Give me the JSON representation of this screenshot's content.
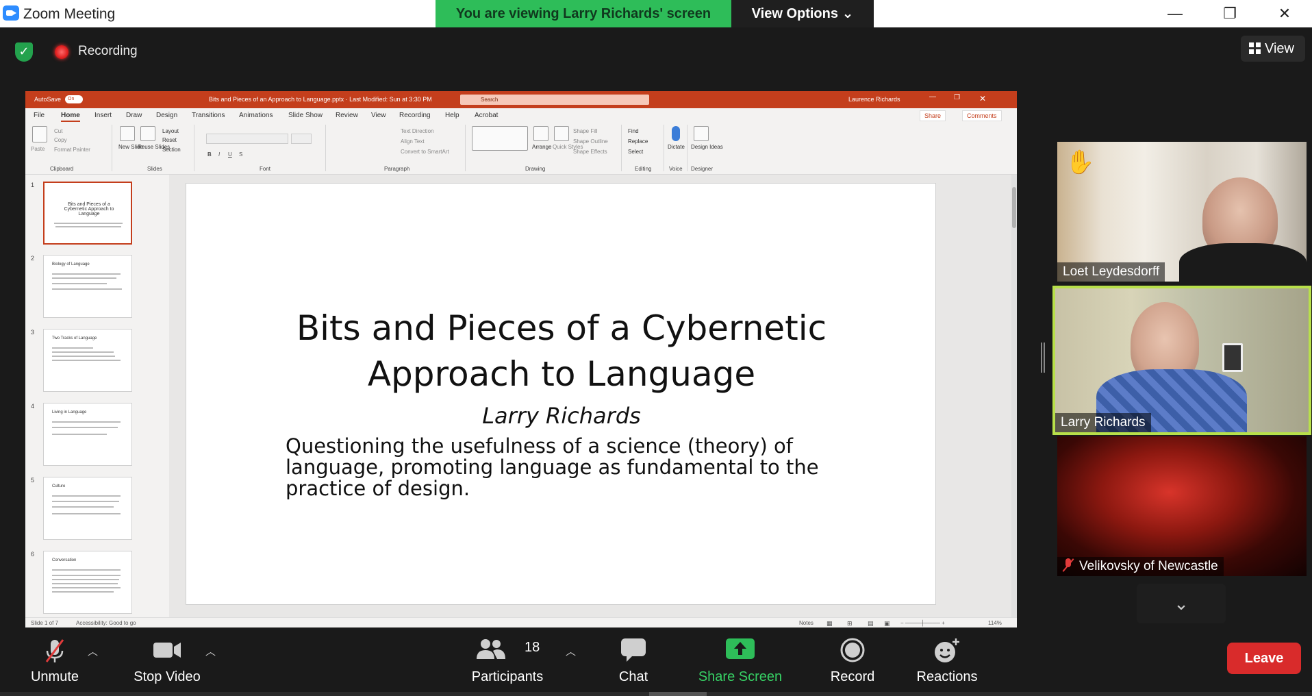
{
  "window": {
    "title": "Zoom Meeting",
    "banner": "You are viewing Larry Richards' screen",
    "view_options": "View Options"
  },
  "top": {
    "recording_label": "Recording",
    "view_label": "View"
  },
  "ppt": {
    "autosave": "AutoSave",
    "autosave_state": "On",
    "file_title": "Bits and Pieces of an Approach to Language.pptx  ·  Last Modified: Sun at 3:30 PM",
    "search_placeholder": "Search",
    "user": "Laurence Richards",
    "menu": [
      "File",
      "Home",
      "Insert",
      "Draw",
      "Design",
      "Transitions",
      "Animations",
      "Slide Show",
      "Review",
      "View",
      "Recording",
      "Help",
      "Acrobat"
    ],
    "share": "Share",
    "comments": "Comments",
    "ribbon": {
      "paste": "Paste",
      "cut": "Cut",
      "copy": "Copy",
      "format_painter": "Format Painter",
      "new_slide": "New Slide",
      "reuse_slides": "Reuse Slides",
      "layout": "Layout",
      "reset": "Reset",
      "section": "Section",
      "text_direction": "Text Direction",
      "align_text": "Align Text",
      "convert_smartart": "Convert to SmartArt",
      "arrange": "Arrange",
      "quick_styles": "Quick Styles",
      "shape_fill": "Shape Fill",
      "shape_outline": "Shape Outline",
      "shape_effects": "Shape Effects",
      "find": "Find",
      "replace": "Replace",
      "select": "Select",
      "dictate": "Dictate",
      "design_ideas": "Design Ideas",
      "groups": [
        "Clipboard",
        "Slides",
        "Font",
        "Paragraph",
        "Drawing",
        "Editing",
        "Voice",
        "Designer"
      ]
    },
    "thumbnails": [
      {
        "num": "1",
        "title": "Bits and Pieces of a Cybernetic Approach to Language"
      },
      {
        "num": "2",
        "title": "Biology of Language"
      },
      {
        "num": "3",
        "title": "Two Tracks of Language"
      },
      {
        "num": "4",
        "title": "Living in Language"
      },
      {
        "num": "5",
        "title": "Culture"
      },
      {
        "num": "6",
        "title": "Conversation"
      }
    ],
    "slide": {
      "title_line1": "Bits and Pieces of a Cybernetic",
      "title_line2": "Approach to Language",
      "author": "Larry Richards",
      "subtitle": "Questioning the usefulness of a science (theory) of language, promoting language as fundamental to the practice of design."
    },
    "status": {
      "slide_count": "Slide 1 of 7",
      "accessibility": "Accessibility: Good to go",
      "notes": "Notes",
      "zoom": "114%"
    }
  },
  "participants": [
    {
      "name": "Loet Leydesdorff",
      "raised_hand": true,
      "muted": false
    },
    {
      "name": "Larry Richards",
      "raised_hand": false,
      "muted": false,
      "active_speaker": true
    },
    {
      "name": "Velikovsky of Newcastle",
      "raised_hand": false,
      "muted": true
    }
  ],
  "toolbar": {
    "unmute": "Unmute",
    "stop_video": "Stop Video",
    "participants": "Participants",
    "participants_count": "18",
    "chat": "Chat",
    "share_screen": "Share Screen",
    "record": "Record",
    "reactions": "Reactions",
    "leave": "Leave"
  },
  "colors": {
    "share_green": "#2ebd59",
    "ppt_accent": "#c43e1c",
    "speaker_highlight": "#b8e04a",
    "leave_red": "#d92b2b"
  }
}
